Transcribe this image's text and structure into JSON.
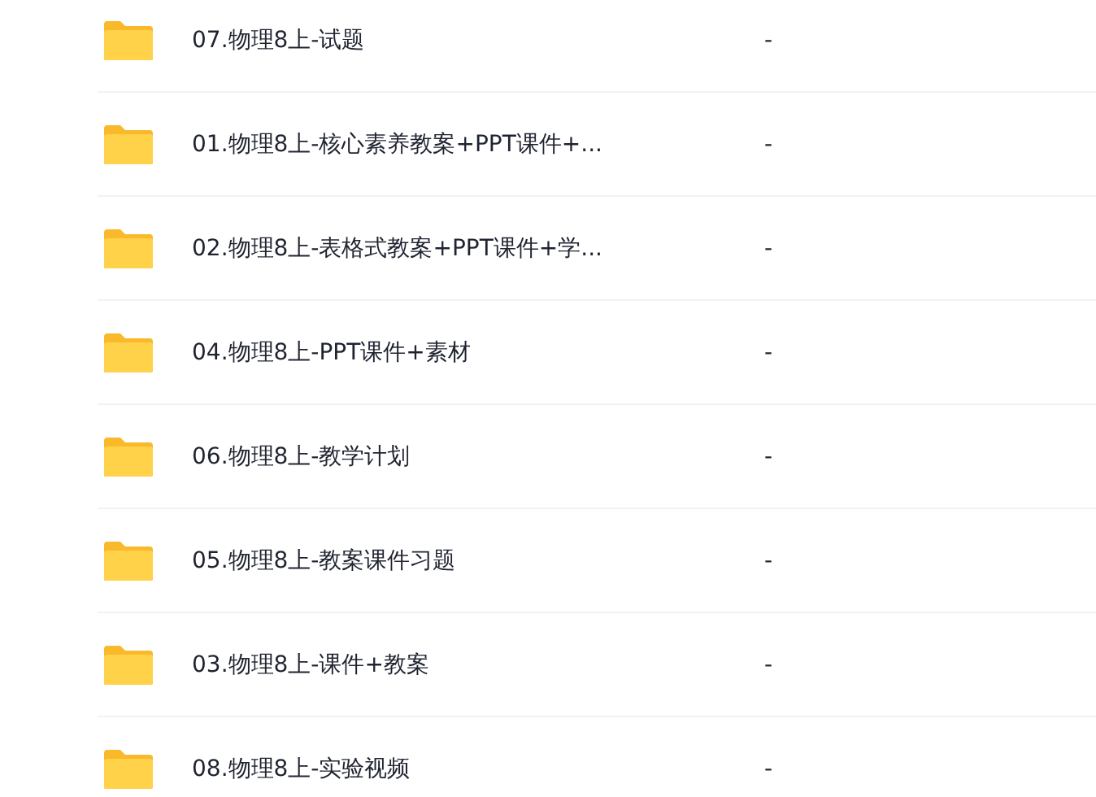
{
  "files": [
    {
      "name": "07.物理8上-试题",
      "size": "-"
    },
    {
      "name": "01.物理8上-核心素养教案+PPT课件+...",
      "size": "-"
    },
    {
      "name": "02.物理8上-表格式教案+PPT课件+学...",
      "size": "-"
    },
    {
      "name": "04.物理8上-PPT课件+素材",
      "size": "-"
    },
    {
      "name": "06.物理8上-教学计划",
      "size": "-"
    },
    {
      "name": "05.物理8上-教案课件习题",
      "size": "-"
    },
    {
      "name": "03.物理8上-课件+教案",
      "size": "-"
    },
    {
      "name": "08.物理8上-实验视频",
      "size": "-"
    }
  ]
}
